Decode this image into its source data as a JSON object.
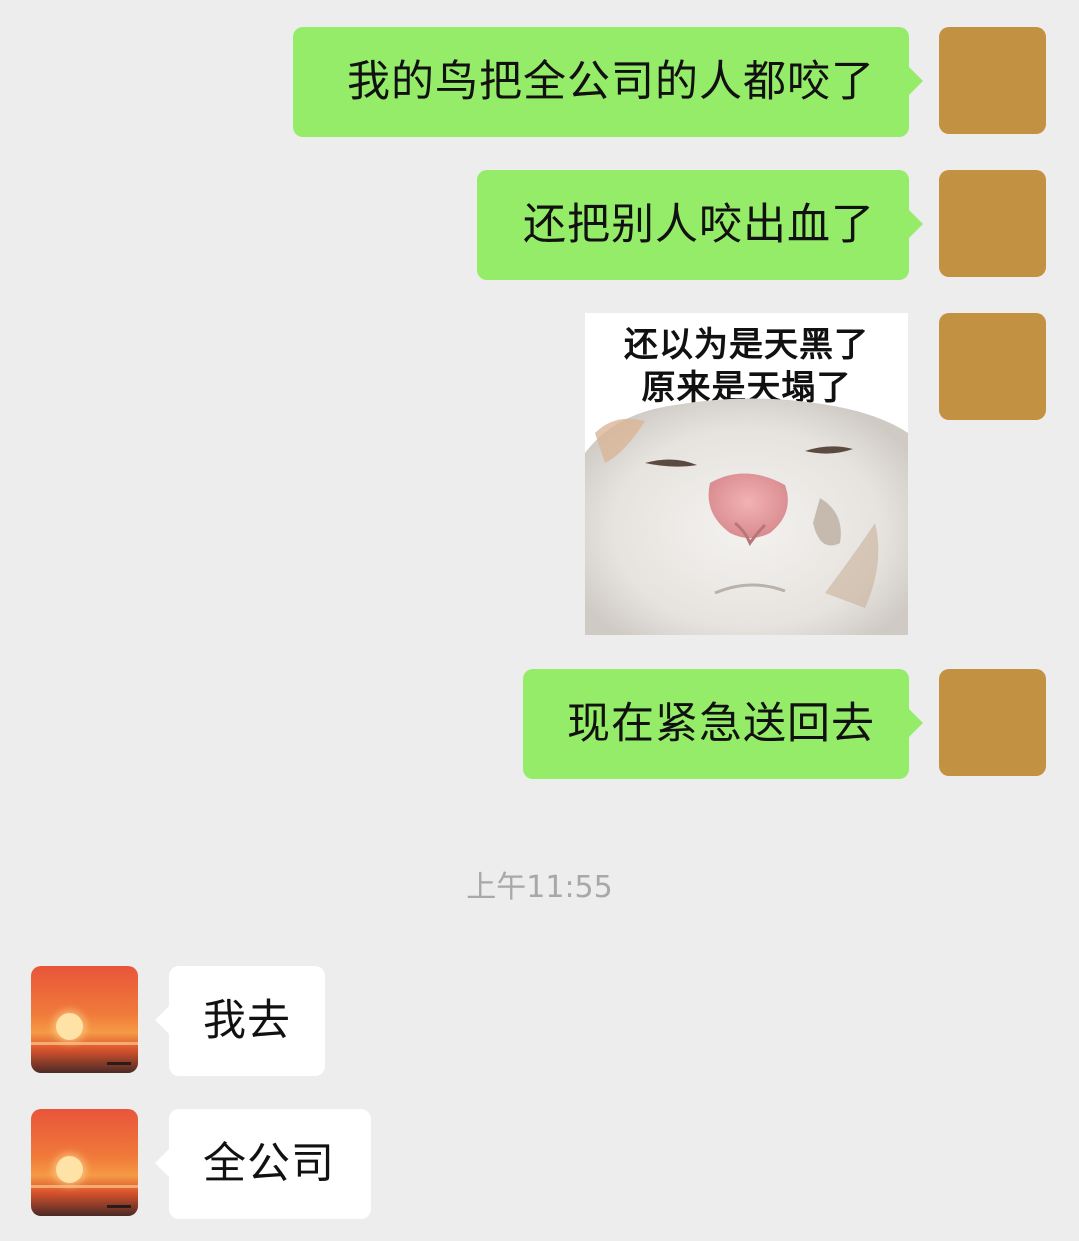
{
  "messages_sent": [
    {
      "text": "我的鸟把全公司的人都咬了"
    },
    {
      "text": "还把别人咬出血了"
    },
    {
      "sticker_caption_line1": "还以为是天黑了",
      "sticker_caption_line2": "原来是天塌了"
    },
    {
      "text": "现在紧急送回去"
    }
  ],
  "timestamp": "上午11:55",
  "messages_received": [
    {
      "text": "我去"
    },
    {
      "text": "全公司"
    }
  ],
  "colors": {
    "background": "#ededed",
    "sent_bubble": "#95ec69",
    "received_bubble": "#ffffff",
    "my_avatar": "#c29242"
  }
}
